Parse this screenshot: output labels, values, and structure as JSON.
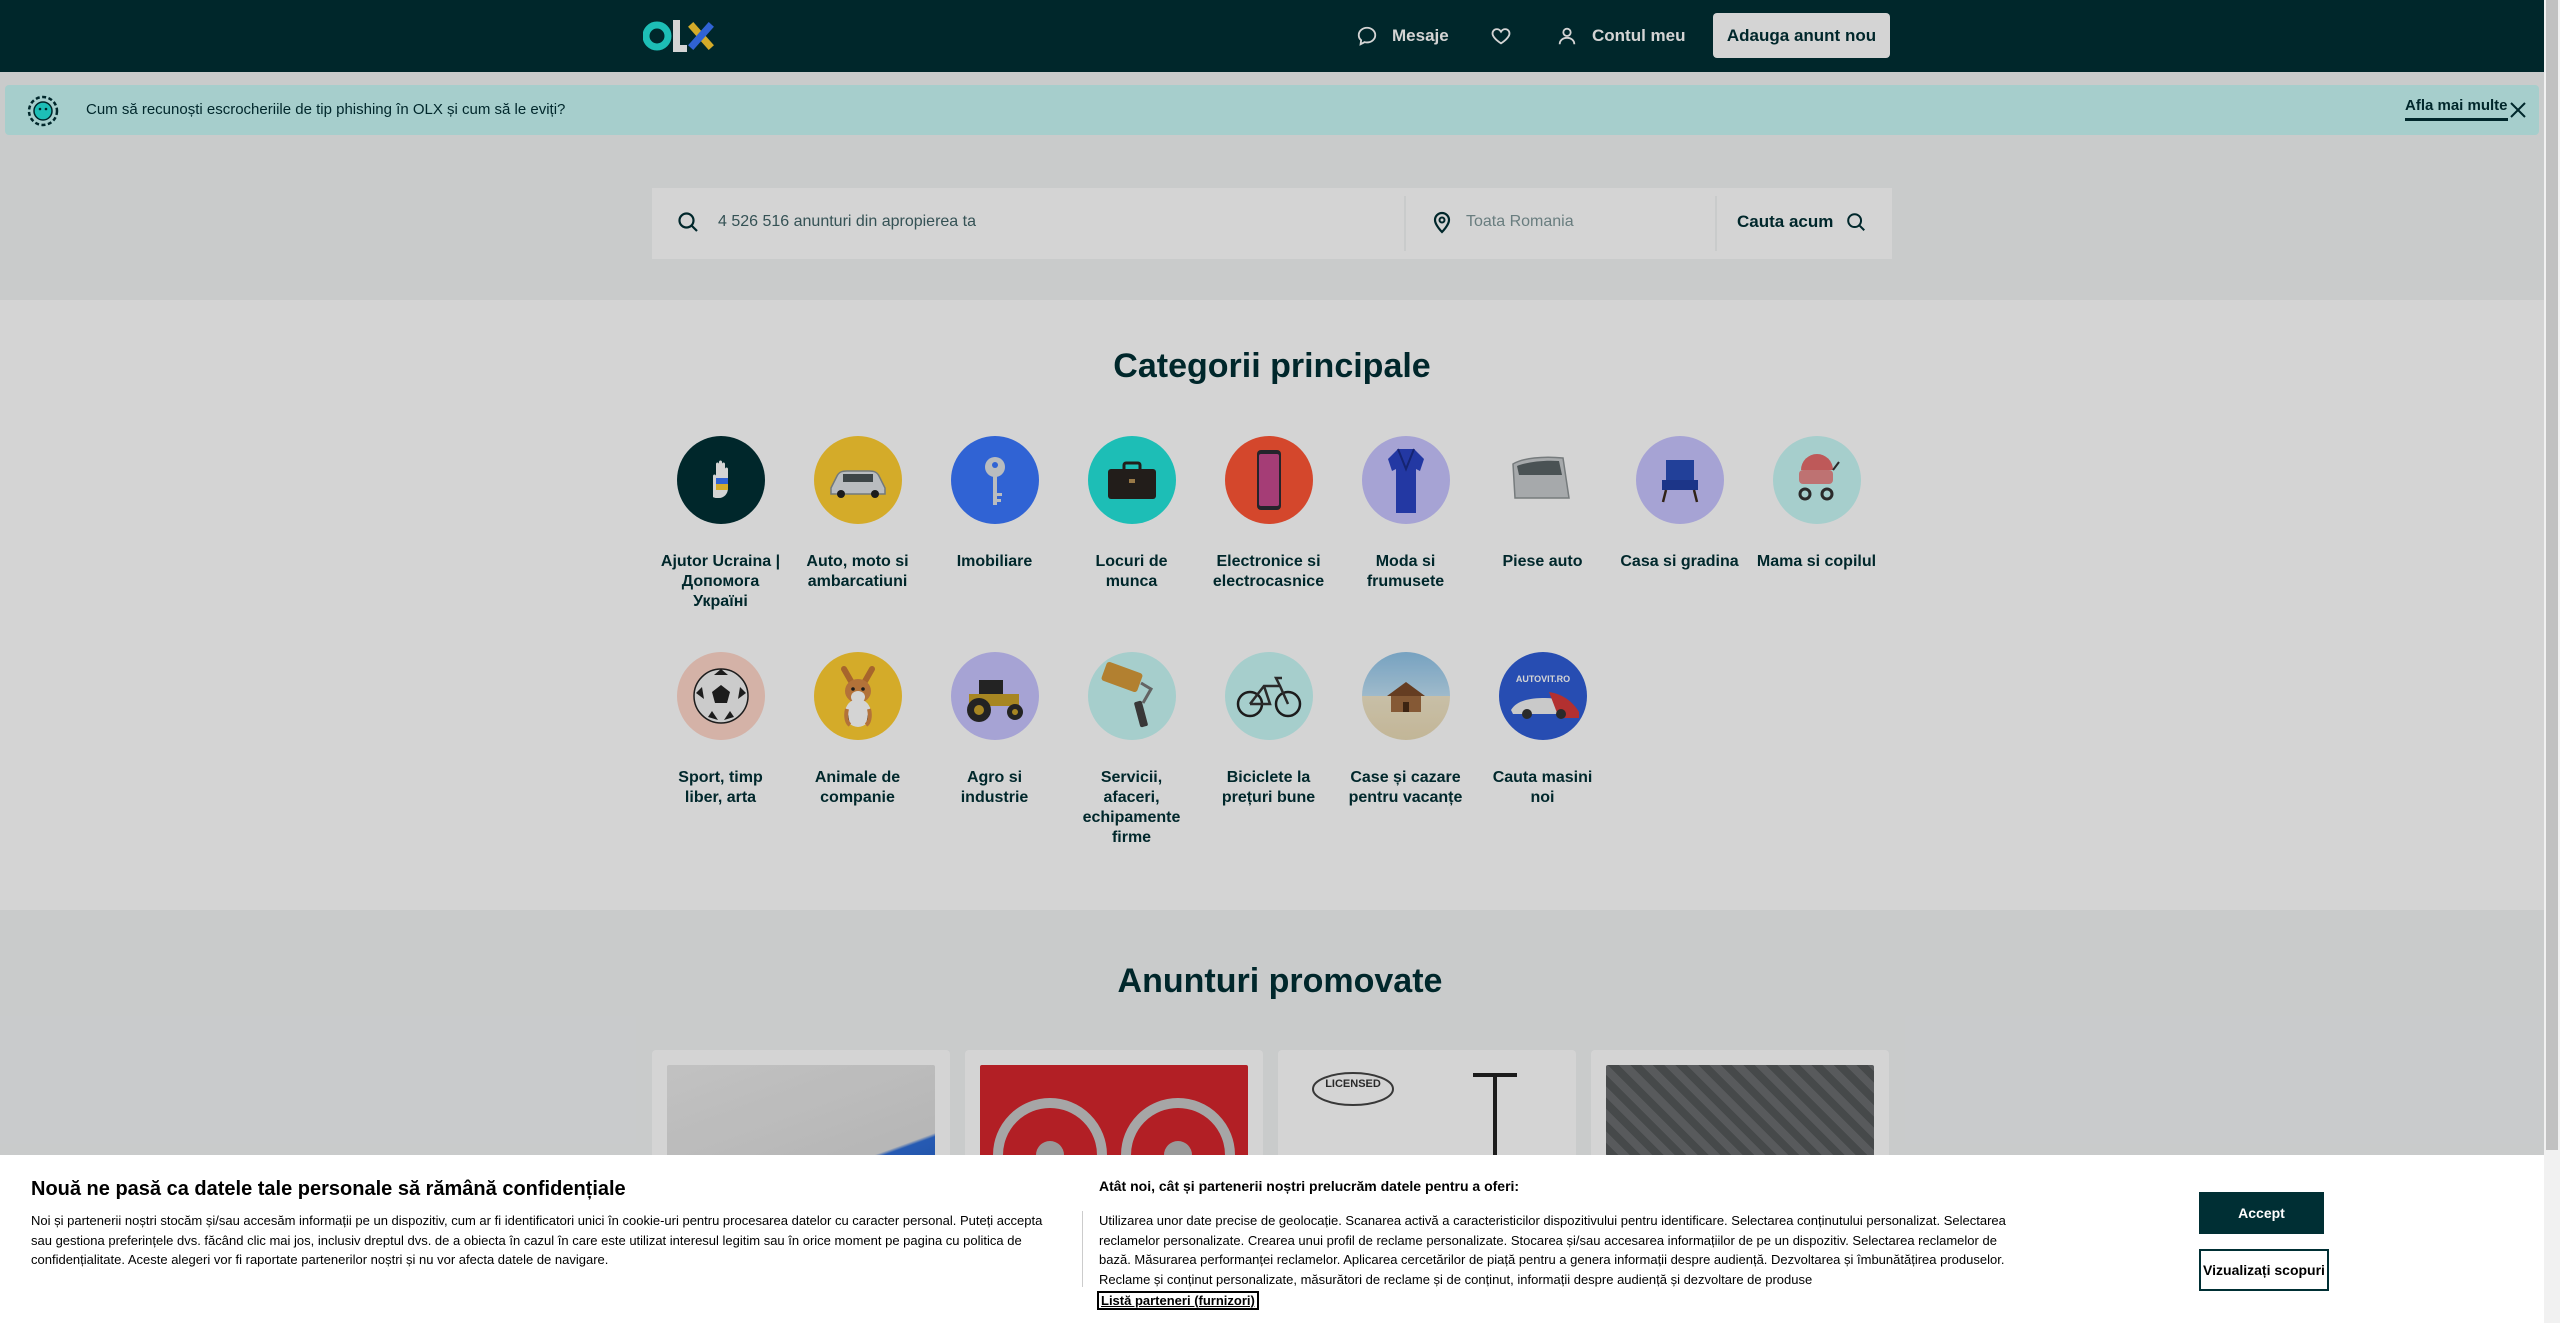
{
  "header": {
    "logo_text": "OLX",
    "messages_label": "Mesaje",
    "account_label": "Contul meu",
    "post_button": "Adauga anunt nou"
  },
  "banner": {
    "text": "Cum să recunoști escrocheriile de tip phishing în OLX și cum să le eviți?",
    "link": "Afla mai multe"
  },
  "search": {
    "placeholder": "4 526 516 anunturi din apropierea ta",
    "location_placeholder": "Toata Romania",
    "button": "Cauta acum"
  },
  "categories": {
    "title": "Categorii principale",
    "items": [
      {
        "label": "Ajutor Ucraina | Допомога Україні",
        "color": "#002f34"
      },
      {
        "label": "Auto, moto si ambarcatiuni",
        "color": "#ffce32"
      },
      {
        "label": "Imobiliare",
        "color": "#3a77ff"
      },
      {
        "label": "Locuri de munca",
        "color": "#23e5db"
      },
      {
        "label": "Electronice si electrocasnice",
        "color": "#ff5636"
      },
      {
        "label": "Moda si frumusete",
        "color": "#c8c4ff"
      },
      {
        "label": "Piese auto",
        "color": "#ffffff"
      },
      {
        "label": "Casa si gradina",
        "color": "#c8c4ff"
      },
      {
        "label": "Mama si copilul",
        "color": "#c8f8f6"
      },
      {
        "label": "Sport, timp liber, arta",
        "color": "#ffd6c9"
      },
      {
        "label": "Animale de companie",
        "color": "#ffce32"
      },
      {
        "label": "Agro si industrie",
        "color": "#c8c4ff"
      },
      {
        "label": "Servicii, afaceri, echipamente firme",
        "color": "#c8f8f6"
      },
      {
        "label": "Biciclete la prețuri bune",
        "color": "#c8f8f6"
      },
      {
        "label": "Case și cazare pentru vacanțe",
        "color": "#ffe9a8"
      },
      {
        "label": "Cauta masini noi",
        "color": "#2f5dd6"
      }
    ]
  },
  "promoted": {
    "title": "Anunturi promovate",
    "licensed_text": "LICENSED"
  },
  "cookie": {
    "title": "Nouă ne pasă ca datele tale personale să rămână confidențiale",
    "body": "Noi și partenerii noștri stocăm și/sau accesăm informații pe un dispozitiv, cum ar fi identificatori unici în cookie-uri pentru procesarea datelor cu caracter personal. Puteți accepta sau gestiona preferințele dvs. făcând clic mai jos, inclusiv dreptul dvs. de a obiecta în cazul în care este utilizat interesul legitim sau în orice moment pe pagina cu politica de confidențialitate. Aceste alegeri vor fi raportate partenerilor noștri și nu vor afecta datele de navigare.",
    "subtitle": "Atât noi, cât și partenerii noștri prelucrăm datele pentru a oferi:",
    "purposes": "Utilizarea unor date precise de geolocație. Scanarea activă a caracteristicilor dispozitivului pentru identificare. Selectarea conținutului personalizat. Selectarea reclamelor personalizate. Crearea unui profil de reclame personalizate. Stocarea și/sau accesarea informațiilor de pe un dispozitiv. Selectarea reclamelor de bază. Măsurarea performanței reclamelor. Aplicarea cercetărilor de piață pentru a genera informații despre audiență. Dezvoltarea și îmbunătățirea produselor. Reclame și conținut personalizate, măsurători de reclame și de conținut, informații despre audiență și dezvoltare de produse",
    "partners_link": "Listă parteneri (furnizori)",
    "accept": "Accept",
    "view_purposes": "Vizualizați scopuri"
  }
}
